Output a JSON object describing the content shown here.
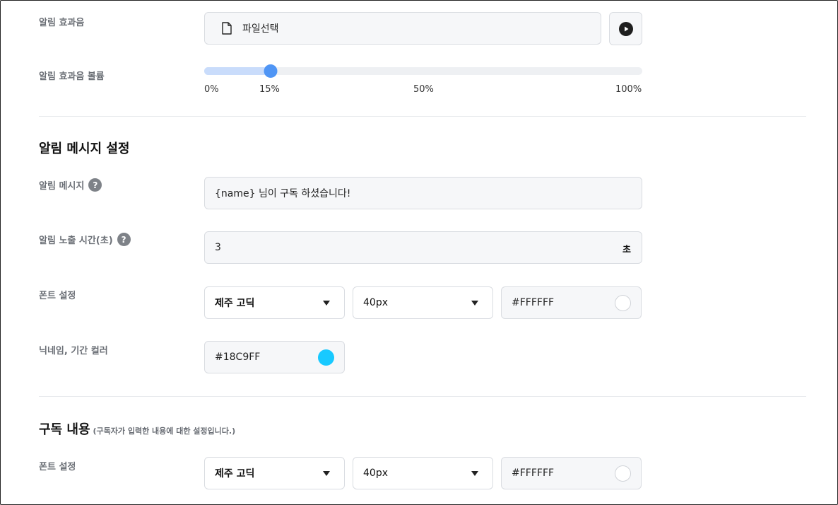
{
  "sound": {
    "label": "알림 효과음",
    "file_button": "파일선택",
    "play_icon": "play-icon",
    "file_icon": "file-icon"
  },
  "volume": {
    "label": "알림 효과음 볼륨",
    "value_percent": 15,
    "ticks": [
      "0%",
      "15%",
      "50%",
      "100%"
    ]
  },
  "message_section": {
    "title": "알림 메시지 설정",
    "message_label": "알림 메시지",
    "message_value": "{name} 님이 구독 하셨습니다!",
    "duration_label": "알림 노출 시간(초)",
    "duration_value": "3",
    "duration_unit": "초",
    "font_label": "폰트 설정",
    "font_family": "제주 고딕",
    "font_size": "40px",
    "font_color": "#FFFFFF",
    "nickname_label": "닉네임, 기간 컬러",
    "nickname_color": "#18C9FF"
  },
  "subscribe_section": {
    "title": "구독 내용",
    "subtitle": "(구독자가 입력한 내용에 대한 설정입니다.)",
    "font_label": "폰트 설정",
    "font_family": "제주 고딕",
    "font_size": "40px",
    "font_color": "#FFFFFF"
  },
  "help_symbol": "?",
  "colors": {
    "accent": "#4F95F5",
    "slider_fill": "#C9DCFB",
    "nickname_swatch": "#18C9FF",
    "font_swatch": "#FFFFFF"
  }
}
